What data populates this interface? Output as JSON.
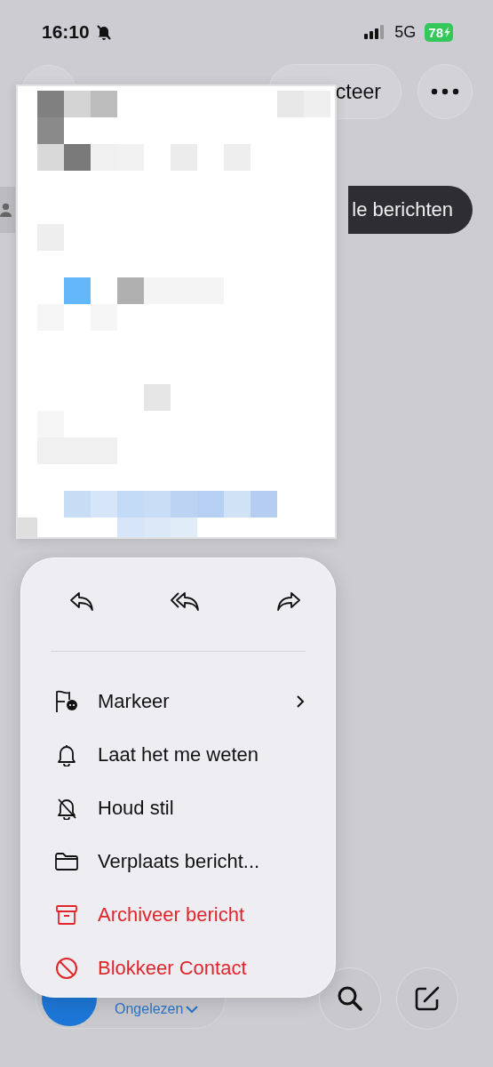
{
  "status_bar": {
    "time": "16:10",
    "network": "5G",
    "battery": "78"
  },
  "toolbar": {
    "select_label": "cteer"
  },
  "filter": {
    "label": "le berichten"
  },
  "quick_actions": [
    {
      "kind": "reply"
    },
    {
      "kind": "reply_all"
    },
    {
      "kind": "forward"
    }
  ],
  "menu": [
    {
      "kind": "flag",
      "label": "Markeer",
      "submenu": true,
      "destructive": false
    },
    {
      "kind": "bell",
      "label": "Laat het me weten",
      "submenu": false,
      "destructive": false
    },
    {
      "kind": "bell_off",
      "label": "Houd stil",
      "submenu": false,
      "destructive": false
    },
    {
      "kind": "folder",
      "label": "Verplaats bericht...",
      "submenu": false,
      "destructive": false
    },
    {
      "kind": "archive",
      "label": "Archiveer bericht",
      "submenu": false,
      "destructive": true
    },
    {
      "kind": "block",
      "label": "Blokkeer Contact",
      "submenu": false,
      "destructive": true
    }
  ],
  "bottom_bar": {
    "filter_label": "Ongelezen"
  }
}
